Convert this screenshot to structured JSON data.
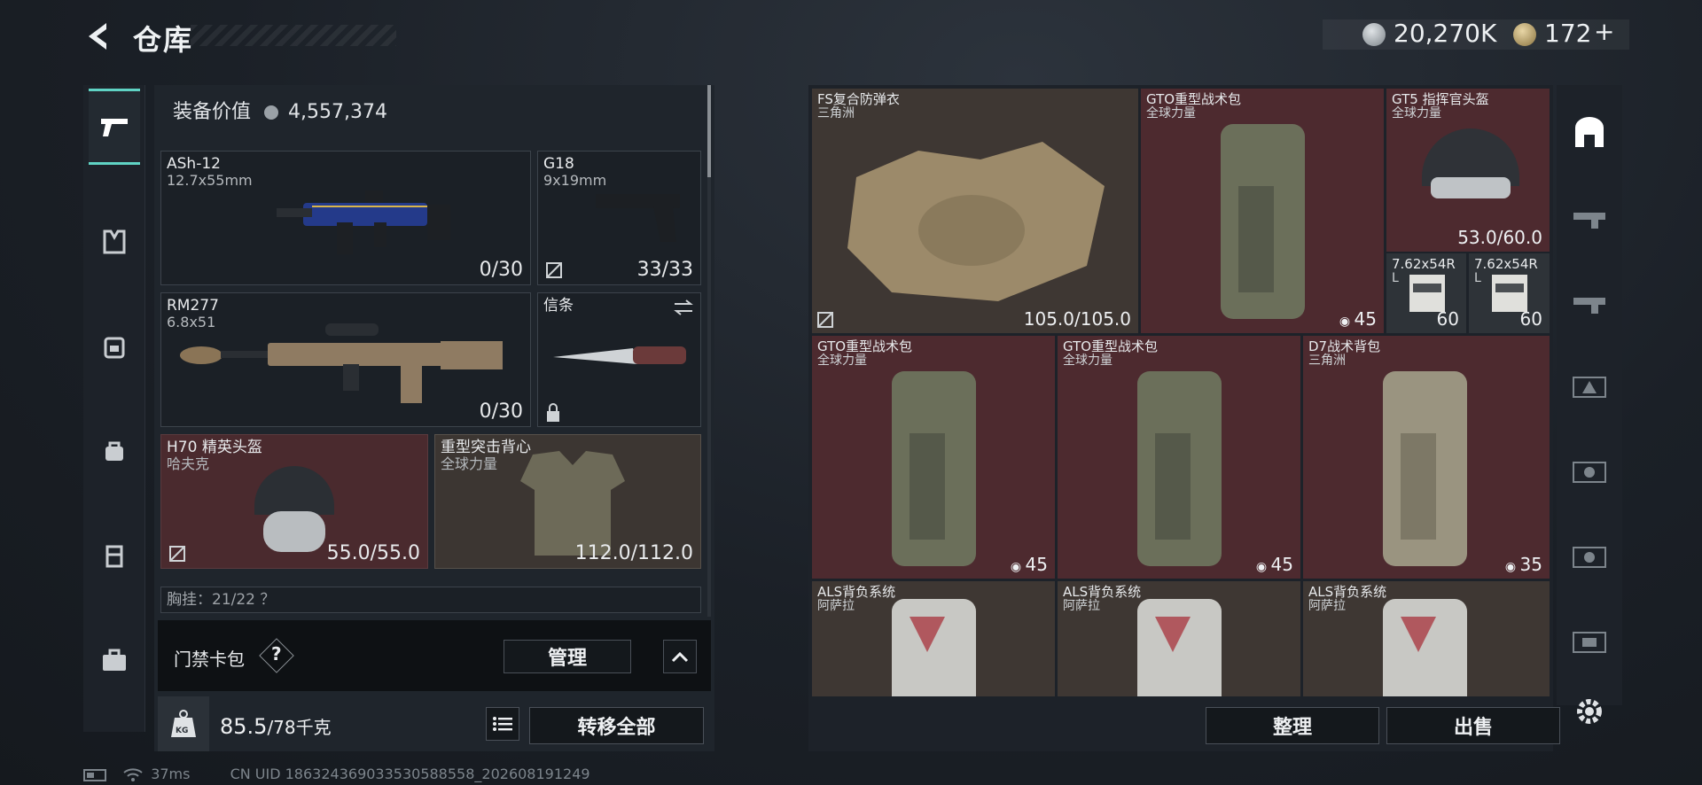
{
  "header": {
    "title": "仓库"
  },
  "currency": {
    "coins": "20,270K",
    "bonds": "172"
  },
  "equipment": {
    "label": "装备价值",
    "value": "4,557,374"
  },
  "slots": [
    {
      "name": "ASh-12",
      "sub": "12.7x55mm",
      "value": "0/30"
    },
    {
      "name": "G18",
      "sub": "9x19mm",
      "value": "33/33"
    },
    {
      "name": "RM277",
      "sub": "6.8x51",
      "value": "0/30"
    },
    {
      "name": "信条",
      "sub": "",
      "value": ""
    },
    {
      "name": "H70 精英头盔",
      "sub": "哈夫克",
      "value": "55.0/55.0"
    },
    {
      "name": "重型突击背心",
      "sub": "全球力量",
      "value": "112.0/112.0"
    }
  ],
  "chest_rig": {
    "label": "胸挂：21/22 ？"
  },
  "keycard": {
    "label": "门禁卡包",
    "help": "?",
    "manage": "管理"
  },
  "weight": {
    "icon_label": "KG",
    "current": "85.5",
    "max": "/78千克",
    "transfer_all": "转移全部"
  },
  "items": [
    {
      "name": "FS复合防弹衣",
      "sub": "三角洲",
      "value": "105.0/105.0"
    },
    {
      "name": "GTO重型战术包",
      "sub": "全球力量",
      "value": "45"
    },
    {
      "name": "GT5 指挥官头盔",
      "sub": "全球力量",
      "value": "53.0/60.0"
    },
    {
      "name": "7.62x54R",
      "sub": "L",
      "value": "60"
    },
    {
      "name": "7.62x54R",
      "sub": "L",
      "value": "60"
    },
    {
      "name": "GTO重型战术包",
      "sub": "全球力量",
      "value": "45"
    },
    {
      "name": "GTO重型战术包",
      "sub": "全球力量",
      "value": "45"
    },
    {
      "name": "D7战术背包",
      "sub": "三角洲",
      "value": "35"
    },
    {
      "name": "ALS背负系统",
      "sub": "阿萨拉",
      "value": ""
    },
    {
      "name": "ALS背负系统",
      "sub": "阿萨拉",
      "value": ""
    },
    {
      "name": "ALS背负系统",
      "sub": "阿萨拉",
      "value": ""
    }
  ],
  "actions": {
    "organize": "整理",
    "sell": "出售"
  },
  "status": {
    "ping": "37ms",
    "uid": "CN UID 1863243690335305885​58_202608191249"
  },
  "colors": {
    "accent": "#5fd3c4",
    "red_tile": "#4d2a2f",
    "tan_tile": "#3e3733"
  }
}
